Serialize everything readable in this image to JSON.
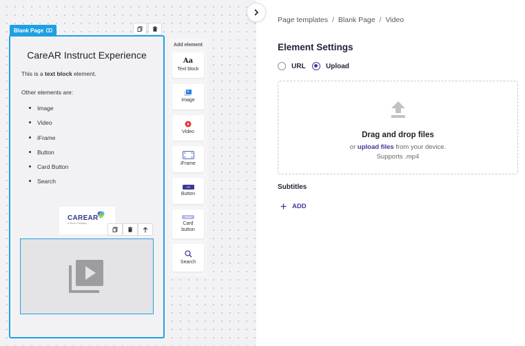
{
  "editor": {
    "page_tag": "Blank Page",
    "page_title": "CareAR Instruct Experience",
    "text_block": {
      "prefix": "This is a ",
      "bold": "text block",
      "suffix": " element."
    },
    "other_label": "Other elements are:",
    "elements": [
      "Image",
      "Video",
      "iFrame",
      "Button",
      "Card Button",
      "Search"
    ],
    "logo": {
      "text": "CAREAR",
      "sub": "a Xerox Company"
    }
  },
  "add_panel": {
    "title": "Add element",
    "items": [
      {
        "label": "Text block",
        "icon": "text-block-icon"
      },
      {
        "label": "Image",
        "icon": "image-icon"
      },
      {
        "label": "Video",
        "icon": "video-icon"
      },
      {
        "label": "iFrame",
        "icon": "iframe-icon"
      },
      {
        "label": "Button",
        "icon": "button-icon"
      },
      {
        "label": "Card button",
        "icon": "card-button-icon"
      },
      {
        "label": "Search",
        "icon": "search-icon"
      }
    ],
    "text_icon_glyph": "Aa"
  },
  "settings": {
    "breadcrumb": [
      "Page templates",
      "Blank Page",
      "Video"
    ],
    "breadcrumb_sep": "/",
    "title": "Element Settings",
    "radio": {
      "url": "URL",
      "upload": "Upload",
      "selected": "upload"
    },
    "dropzone": {
      "title": "Drag and drop files",
      "prefix": "or ",
      "link": "upload files",
      "suffix": " from your device.",
      "supports": "Supports .mp4"
    },
    "subtitles_label": "Subtitles",
    "add_label": "ADD"
  },
  "colors": {
    "accent": "#1fa0e3",
    "primary": "#3f3a9a",
    "video_red": "#e53935"
  }
}
